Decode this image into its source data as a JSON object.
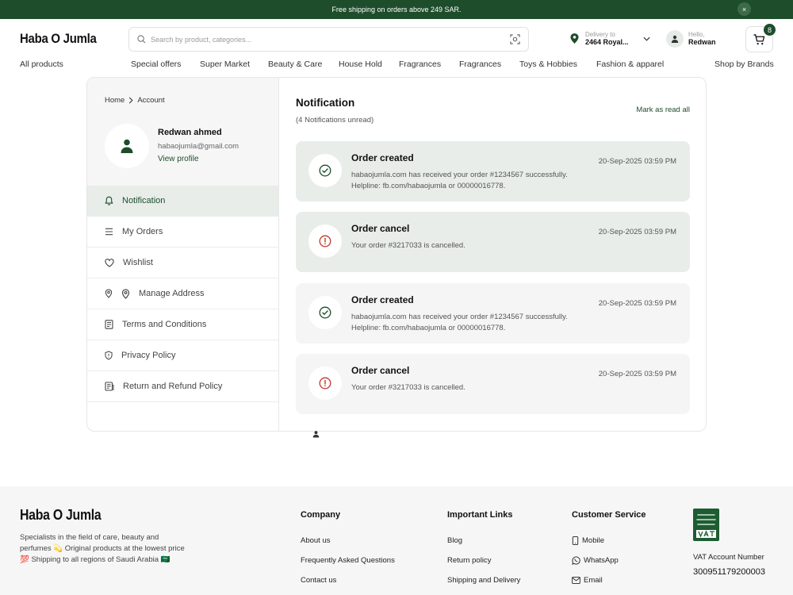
{
  "banner": {
    "text": "Free shipping on orders above 249 SAR.",
    "close": "×"
  },
  "header": {
    "logo": "Haba O Jumla",
    "search_placeholder": "Search by product, categories...",
    "delivery_label": "Delivery to",
    "delivery_value": "2464 Royal...",
    "user_greeting": "Hello,",
    "user_name": "Redwan",
    "cart_count": "8"
  },
  "nav": {
    "all_products": "All products",
    "items": [
      "Special offers",
      "Super Market",
      "Beauty & Care",
      "House Hold",
      "Fragrances",
      "Fragrances",
      "Toys &  Hobbies",
      "Fashion & apparel"
    ],
    "brands": "Shop by Brands"
  },
  "breadcrumb": {
    "home": "Home",
    "current": "Account"
  },
  "profile": {
    "name": "Redwan ahmed",
    "email": "habaojumla@gmail.com",
    "view": "View profile"
  },
  "menu": [
    "Notification",
    "My Orders",
    "Wishlist",
    "Manage Address",
    "Terms and Conditions",
    "Privacy Policy",
    "Return and Refund Policy"
  ],
  "notifications": {
    "title": "Notification",
    "subtitle": "(4 Notifications unread)",
    "mark_read": "Mark as read all",
    "items": [
      {
        "type": "success",
        "title": "Order created",
        "body": "habaojumla.com has received your order #1234567 successfully. Helpline: fb.com/habaojumla or 00000016778.",
        "date": "20-Sep-2025 03:59 PM"
      },
      {
        "type": "cancel",
        "title": "Order cancel",
        "body": "Your order #3217033 is cancelled.",
        "date": "20-Sep-2025 03:59 PM"
      },
      {
        "type": "success",
        "title": "Order created",
        "body": "habaojumla.com has received your order #1234567 successfully. Helpline: fb.com/habaojumla or 00000016778.",
        "date": "20-Sep-2025 03:59 PM"
      },
      {
        "type": "cancel",
        "title": "Order cancel",
        "body": "Your order #3217033 is cancelled.",
        "date": "20-Sep-2025 03:59 PM"
      }
    ]
  },
  "footer": {
    "logo": "Haba O Jumla",
    "desc_1": "Specialists in the field of care, beauty and",
    "desc_2": "perfumes 💫 Original products at the lowest price",
    "desc_3": "💯 Shipping to all regions of Saudi Arabia 🇸🇦",
    "company": {
      "title": "Company",
      "links": [
        "About us",
        "Frequently Asked Questions",
        "Contact us"
      ]
    },
    "important": {
      "title": "Important Links",
      "links": [
        "Blog",
        "Return policy",
        "Shipping and Delivery"
      ]
    },
    "service": {
      "title": "Customer Service",
      "links": [
        "Mobile",
        "WhatsApp",
        "Email"
      ]
    },
    "vat_label": "VAT Account Number",
    "vat_number": "300951179200003"
  },
  "colors": {
    "brand": "#1e4d2b",
    "success": "#1e4d2b",
    "cancel": "#c0392b",
    "unread_bg": "#e8ede9"
  }
}
